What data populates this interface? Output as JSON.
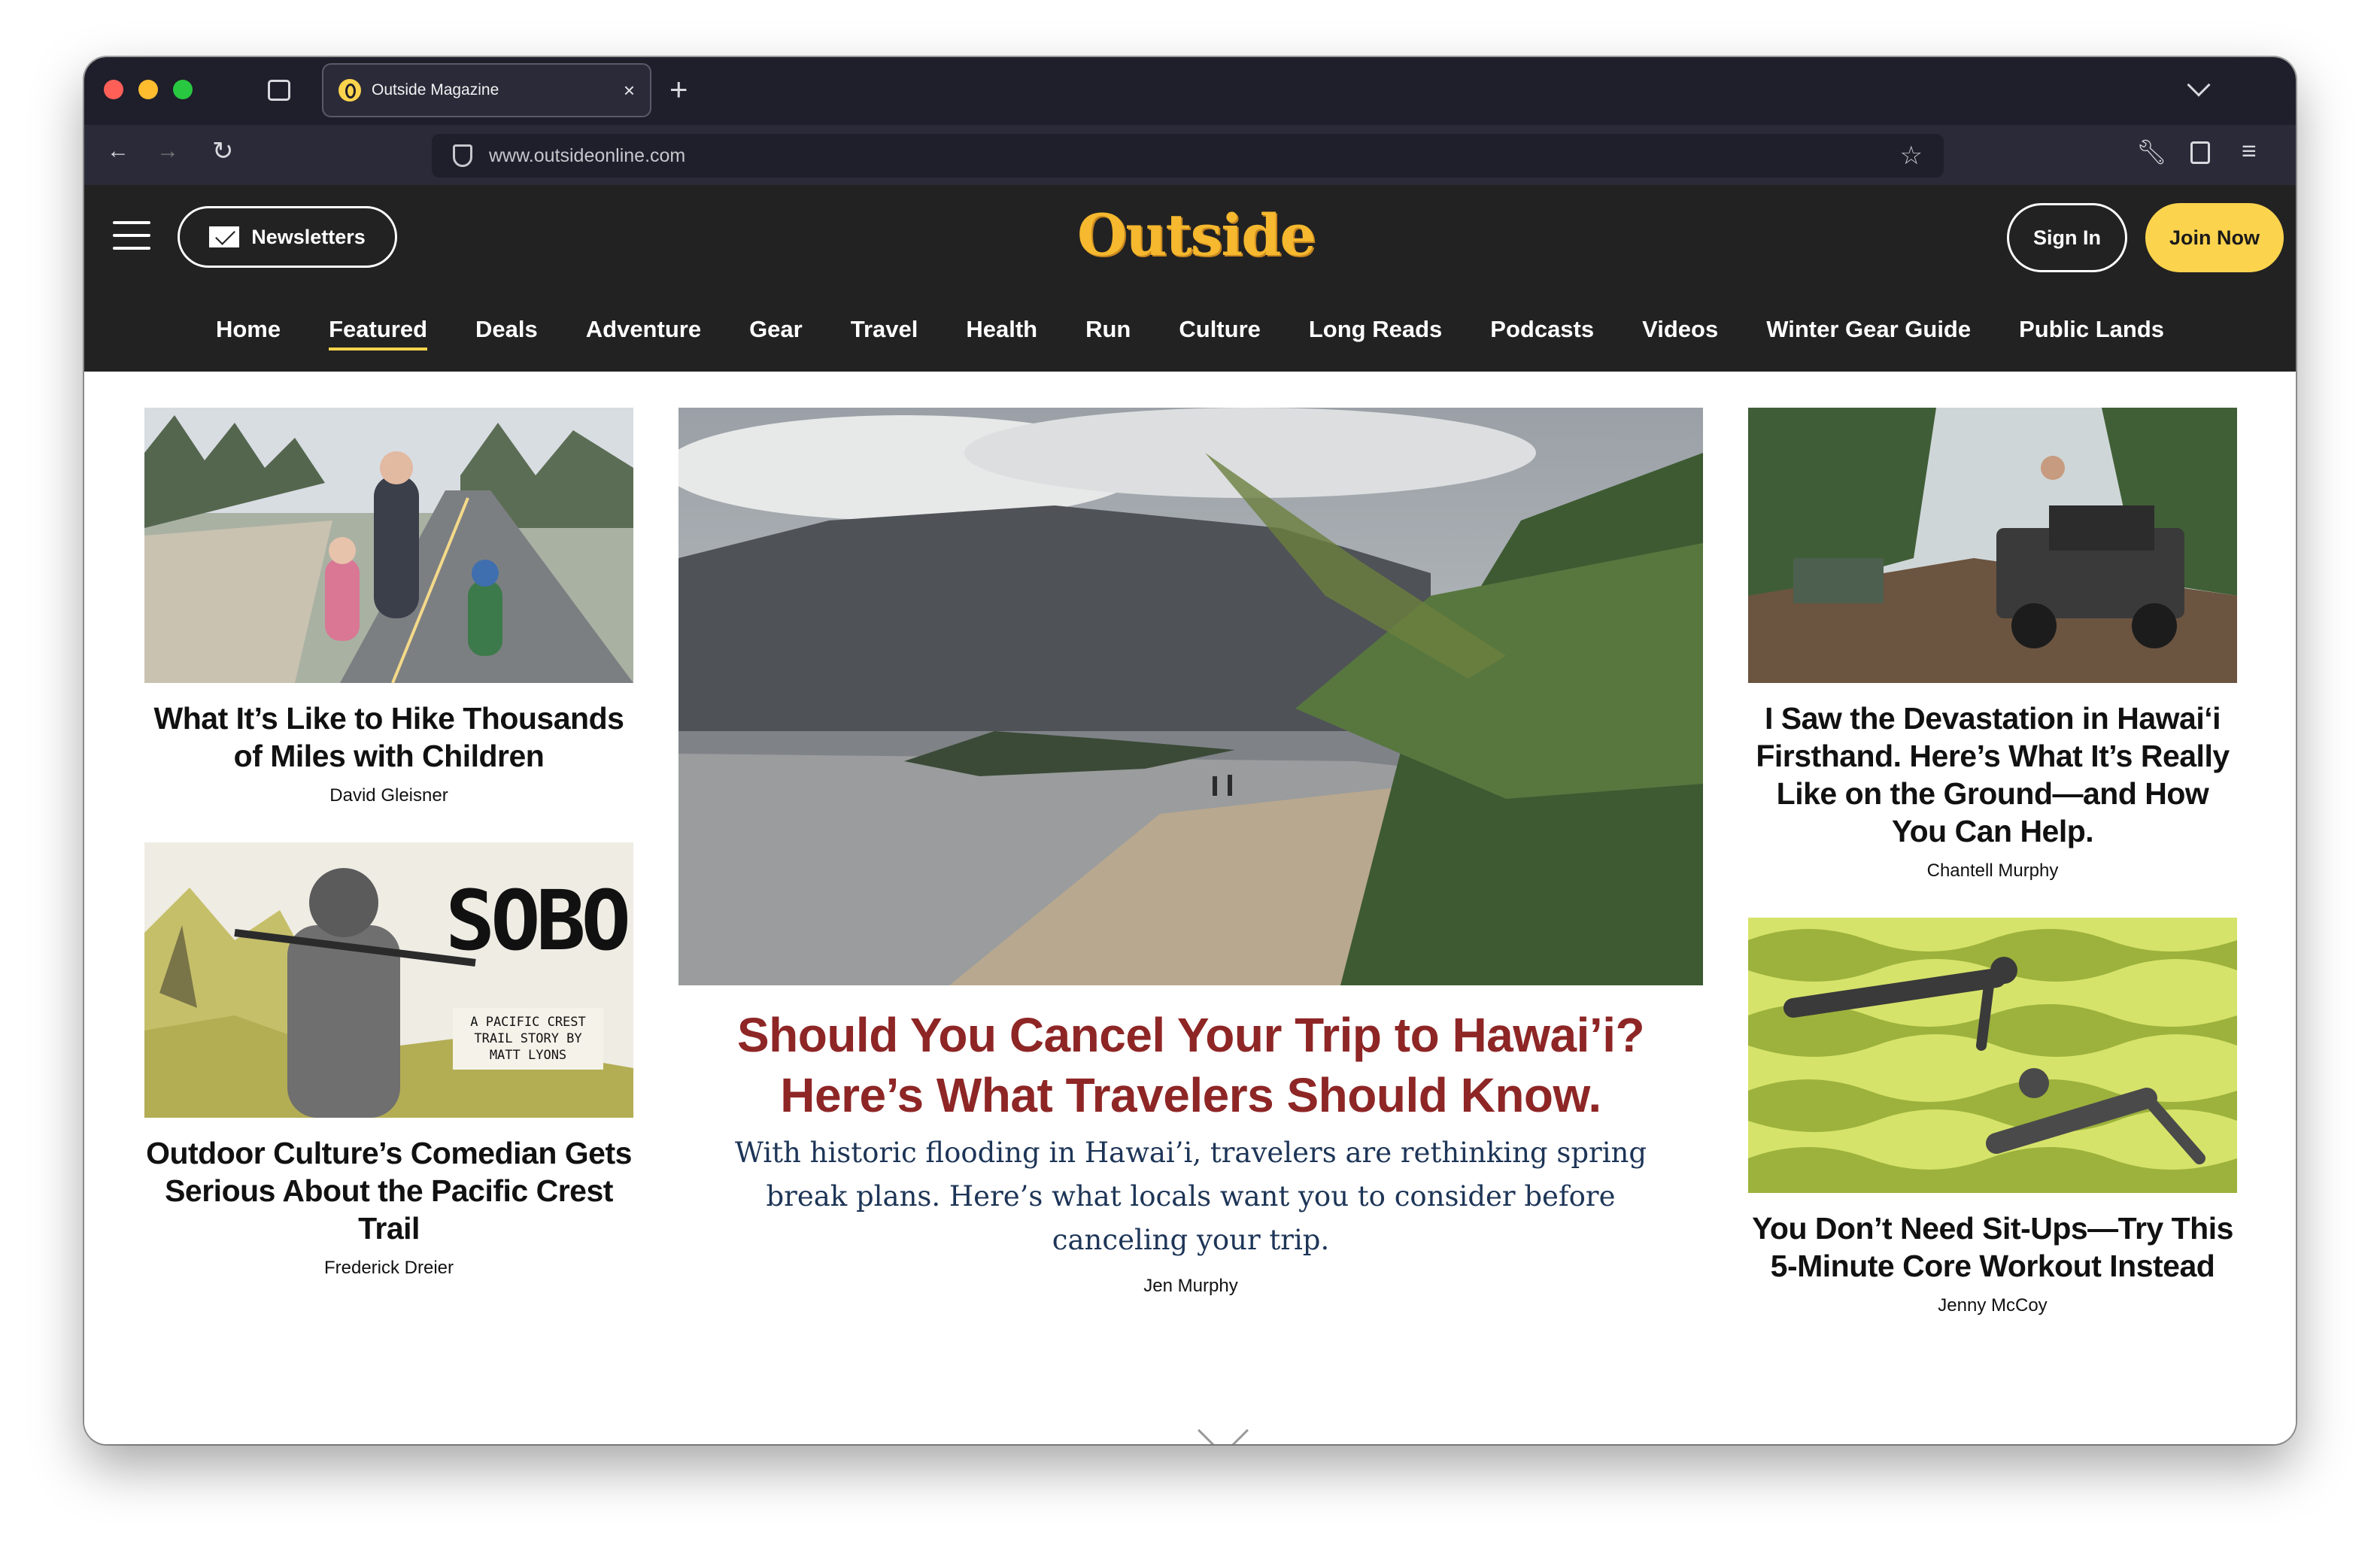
{
  "browser": {
    "tab_title": "Outside Magazine",
    "tab_close": "×",
    "new_tab": "+",
    "url": "www.outsideonline.com"
  },
  "site": {
    "newsletters_label": "Newsletters",
    "logo_text": "Outside",
    "signin_label": "Sign In",
    "join_label": "Join Now",
    "nav": [
      "Home",
      "Featured",
      "Deals",
      "Adventure",
      "Gear",
      "Travel",
      "Health",
      "Run",
      "Culture",
      "Long Reads",
      "Podcasts",
      "Videos",
      "Winter Gear Guide",
      "Public Lands"
    ],
    "active_nav": "Featured"
  },
  "articles": {
    "left_top": {
      "title": "What It’s Like to Hike Thousands of Miles with Children",
      "author": "David Gleisner"
    },
    "left_bottom": {
      "title": "Outdoor Culture’s Comedian Gets Serious About the Pacific Crest Trail",
      "author": "Frederick Dreier",
      "image_text": "SOBO",
      "image_caption": "A PACIFIC CREST TRAIL STORY BY MATT LYONS"
    },
    "main": {
      "title": "Should You Cancel Your Trip to Hawai’i? Here’s What Travelers Should Know.",
      "dek": "With historic flooding in Hawai’i, travelers are rethinking spring break plans. Here’s what locals want you to consider before canceling your trip.",
      "author": "Jen Murphy"
    },
    "right_top": {
      "title": "I Saw the Devastation in Hawai‘i Firsthand. Here’s What It’s Really Like on the Ground—and How You Can Help.",
      "author": "Chantell Murphy"
    },
    "right_bottom": {
      "title": "You Don’t Need Sit-Ups—Try This 5-Minute Core Workout Instead",
      "author": "Jenny McCoy"
    }
  },
  "colors": {
    "accent": "#fcd34d",
    "headline_red": "#8e2626",
    "header_bg": "#222222"
  }
}
